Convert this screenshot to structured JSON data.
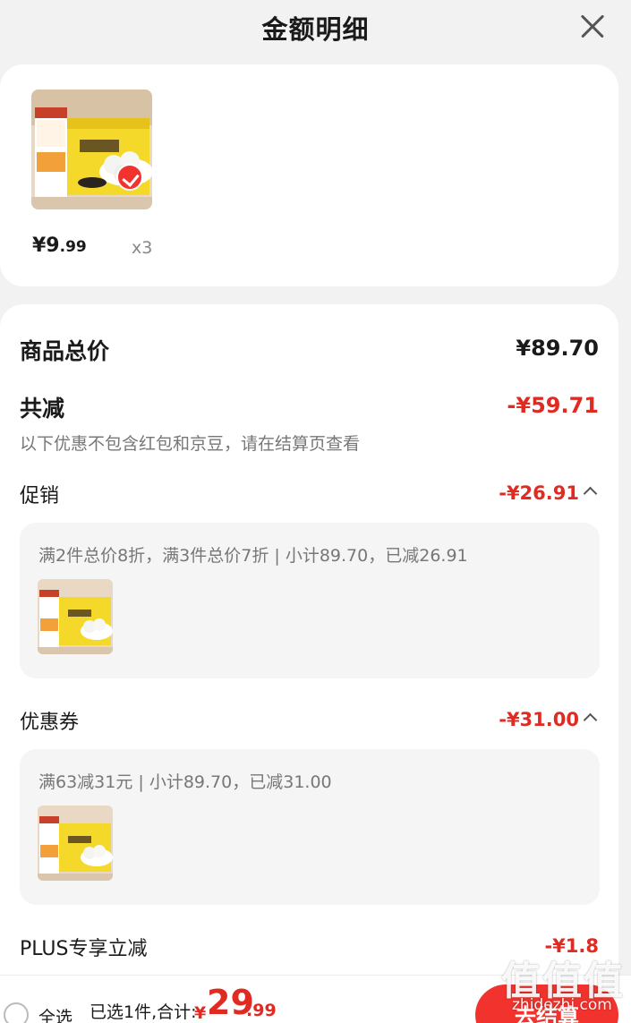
{
  "header": {
    "title": "金额明细"
  },
  "product": {
    "price_int": "¥9",
    "price_dec": ".99",
    "quantity": "x3",
    "selected": true
  },
  "summary": {
    "total_label": "商品总价",
    "total_value": "¥89.70",
    "reduce_label": "共减",
    "reduce_value": "-¥59.71",
    "notice": "以下优惠不包含红包和京豆，请在结算页查看"
  },
  "sections": [
    {
      "label": "促销",
      "value": "-¥26.91",
      "detail": "满2件总价8折，满3件总价7折 | 小计89.70，已减26.91"
    },
    {
      "label": "优惠券",
      "value": "-¥31.00",
      "detail": "满63减31元 | 小计89.70，已减31.00"
    }
  ],
  "plus": {
    "label": "PLUS专享立减",
    "value": "-¥1.8"
  },
  "bottom": {
    "select_all": "全选",
    "selected_summary": "已选1件,合计:",
    "currency": "¥",
    "total_int": "29",
    "total_dec": ".99",
    "checkout": "去结算"
  },
  "watermark": {
    "big": "值值值",
    "small": "zhidezhi.com"
  },
  "colors": {
    "accent": "#e02b22",
    "button": "#f2332d",
    "box_bg": "#f5f5f5"
  }
}
